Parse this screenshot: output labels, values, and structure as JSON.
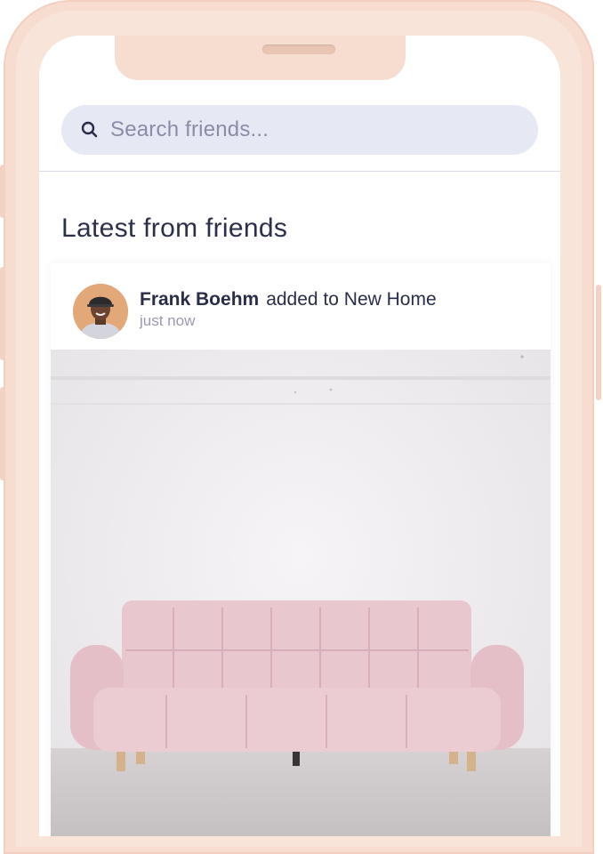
{
  "search": {
    "placeholder": "Search friends...",
    "icon": "search-icon"
  },
  "feed": {
    "section_title": "Latest from friends",
    "posts": [
      {
        "user_name": "Frank Boehm",
        "action": "added to New Home",
        "timestamp": "just now",
        "image": "pink-tufted-sofa-photo"
      }
    ]
  },
  "colors": {
    "frame": "#f7ddd0",
    "search_bg": "#e6e8f4",
    "text_primary": "#2a2d47",
    "text_muted": "#9a9bb0",
    "sofa": "#e8c7cf"
  }
}
